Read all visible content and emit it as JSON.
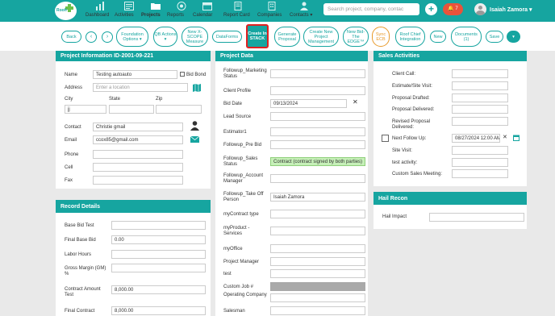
{
  "colors": {
    "teal": "#16a5a0",
    "red": "#e02020",
    "orange": "#e89a2a",
    "alert": "#e8533b"
  },
  "logo": {
    "text": "Roofr"
  },
  "nav": [
    {
      "label": "Dashboard",
      "icon": "dashboard-icon"
    },
    {
      "label": "Activities",
      "icon": "activities-icon"
    },
    {
      "label": "Projects",
      "icon": "folder-icon",
      "active": true
    },
    {
      "label": "Reports",
      "icon": "reports-icon"
    },
    {
      "label": "Calendar",
      "icon": "calendar-icon"
    },
    {
      "label": "Report Card",
      "icon": "report-card-icon"
    },
    {
      "label": "Companies",
      "icon": "companies-icon"
    },
    {
      "label": "Contacts ▾",
      "icon": "contacts-icon"
    }
  ],
  "search": {
    "placeholder": "Search project, company, contac"
  },
  "alert": {
    "label": "🔔 7"
  },
  "user": {
    "name": "Isaiah Zamora ▾"
  },
  "toolbar": {
    "back": "Back",
    "prev": "‹",
    "next": "›",
    "foundation": "Foundation Options ▾",
    "qb": "QB Actions ▾",
    "newx": "New X-SCOPE Measure",
    "dataforms": "DataForms",
    "create": "Create In STACK",
    "proposal": "Generate Proposal",
    "newproj": "Create New Project Management",
    "bidedge": "New Bid-The EDGE™",
    "sync": "Sync ECB",
    "roofchief": "Roof Chief Integration",
    "new": "New",
    "docs": "Documents (1)",
    "save": "Save",
    "more": "▾"
  },
  "project_info": {
    "title": "Project Information ID-2001-09-221",
    "name_label": "Name",
    "name_value": "Testing autoauto",
    "bidbond_label": "Bid Bond",
    "address_label": "Address",
    "address_placeholder": "Enter a location",
    "city_label": "City",
    "state_label": "State",
    "zip_label": "Zip",
    "city_value": "jj",
    "contact_label": "Contact",
    "contact_value": "Christie gmail",
    "email_label": "Email",
    "email_value": "ccox85@gmail.com",
    "phone_label": "Phone",
    "cell_label": "Cell",
    "fax_label": "Fax"
  },
  "record_details": {
    "title": "Record Details",
    "rows": [
      {
        "label": "Base Bid Test",
        "value": ""
      },
      {
        "label": "Final Base Bid",
        "value": "0.00"
      },
      {
        "label": "Labor Hours",
        "value": ""
      },
      {
        "label": "Gross Margin (GM) %",
        "value": ""
      },
      {
        "label": "Contract Amount Test",
        "value": "8,000.00"
      },
      {
        "label": "Final Contract",
        "value": "8,000.00"
      }
    ]
  },
  "project_data": {
    "title": "Project Data",
    "rows": [
      {
        "label": "Followup_Marketing Status",
        "value": ""
      },
      {
        "label": "Client Profile",
        "value": ""
      },
      {
        "label": "Bid Date",
        "value": "09/13/2024"
      },
      {
        "label": "Lead Source",
        "value": ""
      },
      {
        "label": "Estimator1",
        "value": ""
      },
      {
        "label": "Followup_Pre Bid",
        "value": ""
      },
      {
        "label": "Followup_Sales Status",
        "value": "Contract (contract signed by both parties)"
      },
      {
        "label": "Followup_Account Manager",
        "value": ""
      },
      {
        "label": "Followup_Take Off Person",
        "value": "Isaiah Zamora"
      },
      {
        "label": "myContract type",
        "value": ""
      },
      {
        "label": "myProduct - Services",
        "value": ""
      },
      {
        "label": "myOffice",
        "value": ""
      },
      {
        "label": "Project Manager",
        "value": ""
      },
      {
        "label": "test",
        "value": ""
      },
      {
        "label": "Custom Job #",
        "value": ""
      },
      {
        "label": "Operating Company",
        "value": ""
      },
      {
        "label": "Salesman",
        "value": ""
      }
    ],
    "clear": "✕"
  },
  "sales": {
    "title": "Sales Activities",
    "rows": [
      {
        "label": "Client Call:",
        "value": ""
      },
      {
        "label": "Estimate/Site Visit:",
        "value": ""
      },
      {
        "label": "Proposal Drafted:",
        "value": ""
      },
      {
        "label": "Proposal Delivered:",
        "value": ""
      },
      {
        "label": "Revised Proposal Delivered:",
        "value": ""
      },
      {
        "label": "Next Follow Up:",
        "value": "08/27/2024 12:00 AM"
      },
      {
        "label": "Site Visit:",
        "value": ""
      },
      {
        "label": "test activity:",
        "value": ""
      },
      {
        "label": "Custom Sales Meeting:",
        "value": ""
      }
    ],
    "clear": "✕"
  },
  "hail": {
    "title": "Hail Recon",
    "label": "Hail Impact",
    "value": ""
  }
}
